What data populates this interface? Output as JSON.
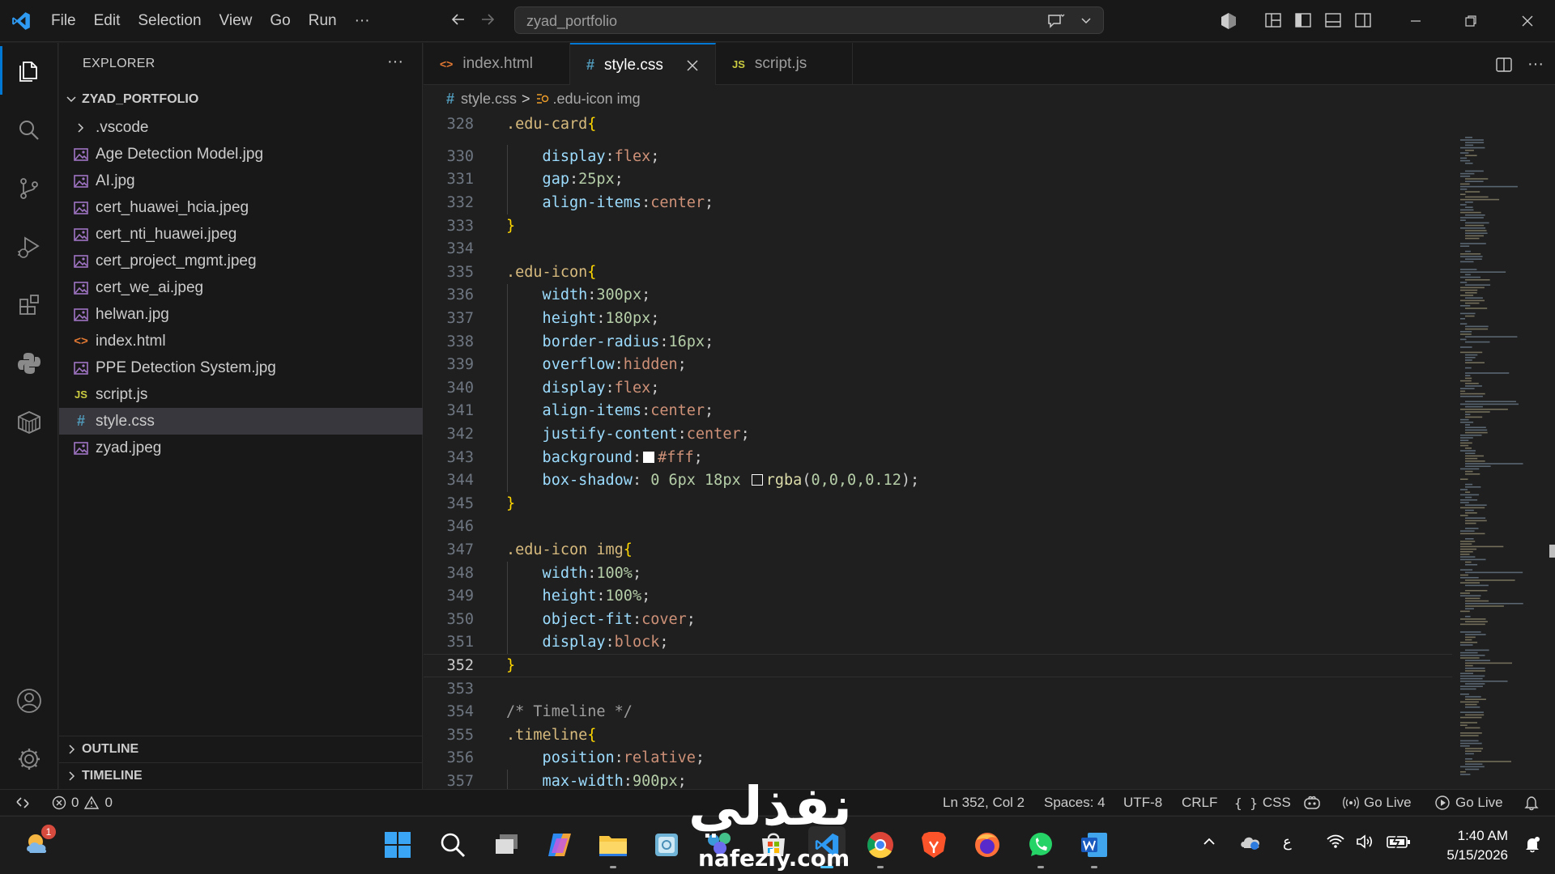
{
  "menu": [
    "File",
    "Edit",
    "Selection",
    "View",
    "Go",
    "Run",
    "···"
  ],
  "search": {
    "value": "zyad_portfolio"
  },
  "explorer": {
    "title": "EXPLORER",
    "more": "···",
    "folder": "ZYAD_PORTFOLIO",
    "items": [
      {
        "name": ".vscode",
        "type": "folder"
      },
      {
        "name": "Age Detection Model.jpg",
        "type": "image"
      },
      {
        "name": "AI.jpg",
        "type": "image"
      },
      {
        "name": "cert_huawei_hcia.jpeg",
        "type": "image"
      },
      {
        "name": "cert_nti_huawei.jpeg",
        "type": "image"
      },
      {
        "name": "cert_project_mgmt.jpeg",
        "type": "image"
      },
      {
        "name": "cert_we_ai.jpeg",
        "type": "image"
      },
      {
        "name": "helwan.jpg",
        "type": "image"
      },
      {
        "name": "index.html",
        "type": "html"
      },
      {
        "name": "PPE Detection System.jpg",
        "type": "image"
      },
      {
        "name": "script.js",
        "type": "js"
      },
      {
        "name": "style.css",
        "type": "css",
        "selected": true
      },
      {
        "name": "zyad.jpeg",
        "type": "image"
      }
    ],
    "sections": [
      "OUTLINE",
      "TIMELINE"
    ]
  },
  "tabs": [
    {
      "label": "index.html",
      "icon": "<>",
      "icon_color": "#e37933"
    },
    {
      "label": "style.css",
      "icon": "#",
      "icon_color": "#519aba",
      "active": true
    },
    {
      "label": "script.js",
      "icon": "JS",
      "icon_color": "#cbcb41"
    }
  ],
  "breadcrumb": {
    "file": "style.css",
    "separator": ">",
    "symbol": ".edu-icon img"
  },
  "code_lines": [
    {
      "n": "328",
      "t": [
        [
          ".edu-card",
          "sel"
        ],
        [
          "{",
          "brace"
        ]
      ]
    },
    {
      "n": "330",
      "t": [
        [
          "    display",
          "prop"
        ],
        [
          ":",
          "punc"
        ],
        [
          "flex",
          "val"
        ],
        [
          ";",
          "punc"
        ]
      ]
    },
    {
      "n": "331",
      "t": [
        [
          "    gap",
          "prop"
        ],
        [
          ":",
          "punc"
        ],
        [
          "25px",
          "num"
        ],
        [
          ";",
          "punc"
        ]
      ]
    },
    {
      "n": "332",
      "t": [
        [
          "    align-items",
          "prop"
        ],
        [
          ":",
          "punc"
        ],
        [
          "center",
          "val"
        ],
        [
          ";",
          "punc"
        ]
      ]
    },
    {
      "n": "333",
      "t": [
        [
          "}",
          "brace"
        ]
      ]
    },
    {
      "n": "334",
      "t": []
    },
    {
      "n": "335",
      "t": [
        [
          ".edu-icon",
          "sel"
        ],
        [
          "{",
          "brace"
        ]
      ]
    },
    {
      "n": "336",
      "t": [
        [
          "    width",
          "prop"
        ],
        [
          ":",
          "punc"
        ],
        [
          "300px",
          "num"
        ],
        [
          ";",
          "punc"
        ]
      ]
    },
    {
      "n": "337",
      "t": [
        [
          "    height",
          "prop"
        ],
        [
          ":",
          "punc"
        ],
        [
          "180px",
          "num"
        ],
        [
          ";",
          "punc"
        ]
      ]
    },
    {
      "n": "338",
      "t": [
        [
          "    border-radius",
          "prop"
        ],
        [
          ":",
          "punc"
        ],
        [
          "16px",
          "num"
        ],
        [
          ";",
          "punc"
        ]
      ]
    },
    {
      "n": "339",
      "t": [
        [
          "    overflow",
          "prop"
        ],
        [
          ":",
          "punc"
        ],
        [
          "hidden",
          "val"
        ],
        [
          ";",
          "punc"
        ]
      ]
    },
    {
      "n": "340",
      "t": [
        [
          "    display",
          "prop"
        ],
        [
          ":",
          "punc"
        ],
        [
          "flex",
          "val"
        ],
        [
          ";",
          "punc"
        ]
      ]
    },
    {
      "n": "341",
      "t": [
        [
          "    align-items",
          "prop"
        ],
        [
          ":",
          "punc"
        ],
        [
          "center",
          "val"
        ],
        [
          ";",
          "punc"
        ]
      ]
    },
    {
      "n": "342",
      "t": [
        [
          "    justify-content",
          "prop"
        ],
        [
          ":",
          "punc"
        ],
        [
          "center",
          "val"
        ],
        [
          ";",
          "punc"
        ]
      ]
    },
    {
      "n": "343",
      "t": [
        [
          "    background",
          "prop"
        ],
        [
          ":",
          "punc"
        ],
        [
          "SWATCH_WHITE",
          "swatch"
        ],
        [
          "#fff",
          "val"
        ],
        [
          ";",
          "punc"
        ]
      ]
    },
    {
      "n": "344",
      "t": [
        [
          "    box-shadow",
          "prop"
        ],
        [
          ": ",
          "punc"
        ],
        [
          "0 6px 18px ",
          "num"
        ],
        [
          "SWATCH_DARK",
          "swatch"
        ],
        [
          "rgba",
          "fn"
        ],
        [
          "(",
          "punc"
        ],
        [
          "0,0,0,0.12",
          "num"
        ],
        [
          ")",
          "punc"
        ],
        [
          ";",
          "punc"
        ]
      ]
    },
    {
      "n": "345",
      "t": [
        [
          "}",
          "brace"
        ]
      ]
    },
    {
      "n": "346",
      "t": []
    },
    {
      "n": "347",
      "t": [
        [
          ".edu-icon img",
          "sel"
        ],
        [
          "{",
          "brace"
        ]
      ]
    },
    {
      "n": "348",
      "t": [
        [
          "    width",
          "prop"
        ],
        [
          ":",
          "punc"
        ],
        [
          "100%",
          "num"
        ],
        [
          ";",
          "punc"
        ]
      ]
    },
    {
      "n": "349",
      "t": [
        [
          "    height",
          "prop"
        ],
        [
          ":",
          "punc"
        ],
        [
          "100%",
          "num"
        ],
        [
          ";",
          "punc"
        ]
      ]
    },
    {
      "n": "350",
      "t": [
        [
          "    object-fit",
          "prop"
        ],
        [
          ":",
          "punc"
        ],
        [
          "cover",
          "val"
        ],
        [
          ";",
          "punc"
        ]
      ]
    },
    {
      "n": "351",
      "t": [
        [
          "    display",
          "prop"
        ],
        [
          ":",
          "punc"
        ],
        [
          "block",
          "val"
        ],
        [
          ";",
          "punc"
        ]
      ]
    },
    {
      "n": "352",
      "t": [
        [
          "}",
          "brace"
        ]
      ],
      "current": true
    },
    {
      "n": "353",
      "t": []
    },
    {
      "n": "354",
      "t": [
        [
          "/* Timeline */",
          "cmt"
        ]
      ]
    },
    {
      "n": "355",
      "t": [
        [
          ".timeline",
          "sel"
        ],
        [
          "{",
          "brace"
        ]
      ]
    },
    {
      "n": "356",
      "t": [
        [
          "    position",
          "prop"
        ],
        [
          ":",
          "punc"
        ],
        [
          "relative",
          "val"
        ],
        [
          ";",
          "punc"
        ]
      ]
    },
    {
      "n": "357",
      "t": [
        [
          "    max-width",
          "prop"
        ],
        [
          ":",
          "punc"
        ],
        [
          "900px",
          "num"
        ],
        [
          ";",
          "punc"
        ]
      ]
    }
  ],
  "status": {
    "errors": "0",
    "warnings": "0",
    "position": "Ln 352, Col 2",
    "spaces": "Spaces: 4",
    "encoding": "UTF-8",
    "eol": "CRLF",
    "language": "CSS",
    "golive1": "Go Live",
    "golive2": "Go Live"
  },
  "taskbar": {
    "weather_badge": "1",
    "ime": "ع",
    "time": "1:40 AM",
    "date": "5/15/2026"
  },
  "watermark": {
    "arabic": "نفذلي",
    "latin": "nafezly.com"
  },
  "colors": {
    "accent": "#0078d4",
    "bg": "#1f1f1f",
    "chrome": "#181818"
  }
}
